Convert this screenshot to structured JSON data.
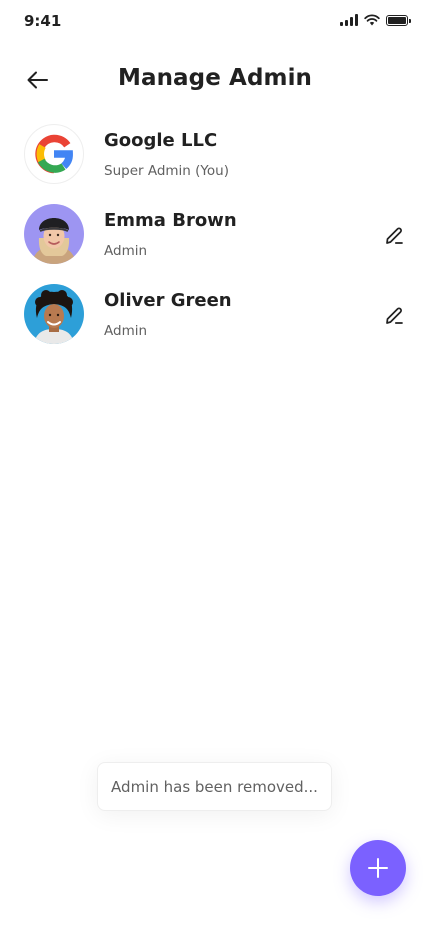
{
  "status_bar": {
    "time": "9:41"
  },
  "header": {
    "title": "Manage Admin"
  },
  "admins": [
    {
      "name": "Google LLC",
      "role": "Super Admin (You)",
      "avatar": "google-logo",
      "editable": false
    },
    {
      "name": "Emma Brown",
      "role": "Admin",
      "avatar": "avatar-emma",
      "editable": true
    },
    {
      "name": "Oliver Green",
      "role": "Admin",
      "avatar": "avatar-oliver",
      "editable": true
    }
  ],
  "toast": {
    "message": "Admin has been removed..."
  },
  "fab": {
    "icon": "plus-icon"
  },
  "icons": {
    "back": "arrow-left-icon",
    "edit": "pencil-icon"
  },
  "colors": {
    "accent": "#7B61FF",
    "text": "#212121",
    "muted": "#616161"
  }
}
